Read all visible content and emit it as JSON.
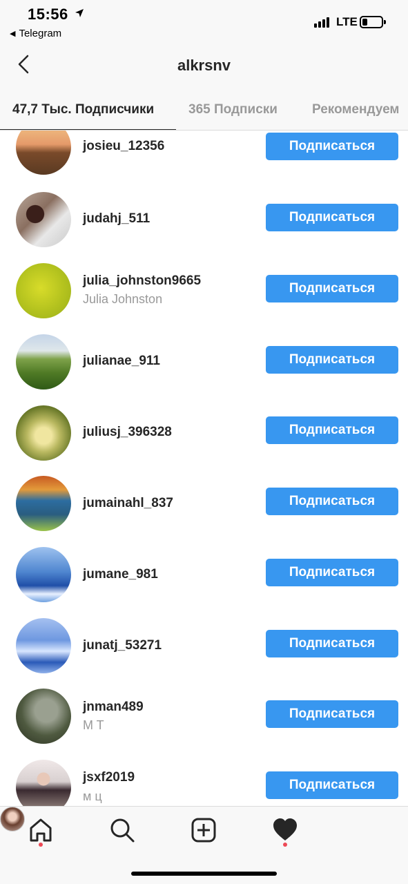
{
  "status_bar": {
    "time": "15:56",
    "back_app": "Telegram",
    "network": "LTE"
  },
  "header": {
    "title": "alkrsnv"
  },
  "tabs": [
    {
      "label": "47,7 Тыс. Подписчики",
      "active": true
    },
    {
      "label": "365 Подписки",
      "active": false
    },
    {
      "label": "Рекомендуем",
      "active": false
    }
  ],
  "follow_label": "Подписаться",
  "followers": [
    {
      "username": "josieu_12356",
      "fullname": ""
    },
    {
      "username": "judahj_511",
      "fullname": ""
    },
    {
      "username": "julia_johnston9665",
      "fullname": "Julia Johnston"
    },
    {
      "username": "julianae_911",
      "fullname": ""
    },
    {
      "username": "juliusj_396328",
      "fullname": ""
    },
    {
      "username": "jumainahl_837",
      "fullname": ""
    },
    {
      "username": "jumane_981",
      "fullname": ""
    },
    {
      "username": "junatj_53271",
      "fullname": ""
    },
    {
      "username": "jnman489",
      "fullname": "M T"
    },
    {
      "username": "jsxf2019",
      "fullname": "м ц"
    }
  ],
  "bottom_nav": {
    "items": [
      {
        "icon": "home-icon",
        "notification": true
      },
      {
        "icon": "search-icon",
        "notification": false
      },
      {
        "icon": "add-post-icon",
        "notification": false
      },
      {
        "icon": "heart-icon",
        "notification": true
      },
      {
        "icon": "profile-avatar",
        "notification": false
      }
    ]
  },
  "colors": {
    "accent": "#3897f0",
    "notification_dot": "#ed4956",
    "secondary_text": "#999999"
  }
}
